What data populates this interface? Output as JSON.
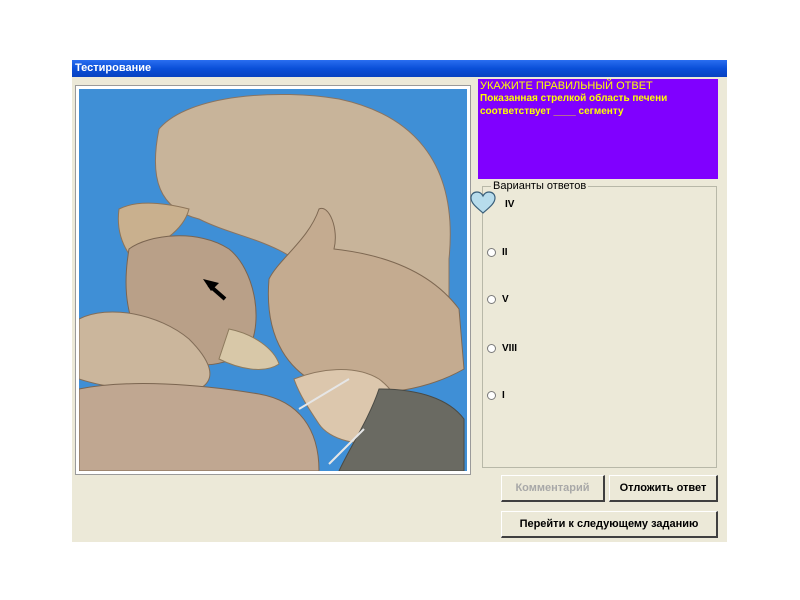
{
  "window": {
    "title": "Тестирование"
  },
  "question": {
    "heading": "УКАЖИТЕ ПРАВИЛЬНЫЙ ОТВЕТ",
    "text": "Показанная стрелкой область печени соответствует ____ сегменту"
  },
  "answers": {
    "legend": "Варианты ответов",
    "options": [
      {
        "label": "IV",
        "marker": "heart-icon"
      },
      {
        "label": "II",
        "marker": "radio"
      },
      {
        "label": "V",
        "marker": "radio"
      },
      {
        "label": "VIII",
        "marker": "radio"
      },
      {
        "label": "I",
        "marker": "radio"
      }
    ]
  },
  "buttons": {
    "comment": "Комментарий",
    "postpone": "Отложить ответ",
    "next": "Перейти к следующему заданию"
  },
  "colors": {
    "question_bg": "#8000ff",
    "question_text": "#ffff00",
    "photo_bg": "#3f8fd6",
    "titlebar": "#0a4fd8"
  }
}
